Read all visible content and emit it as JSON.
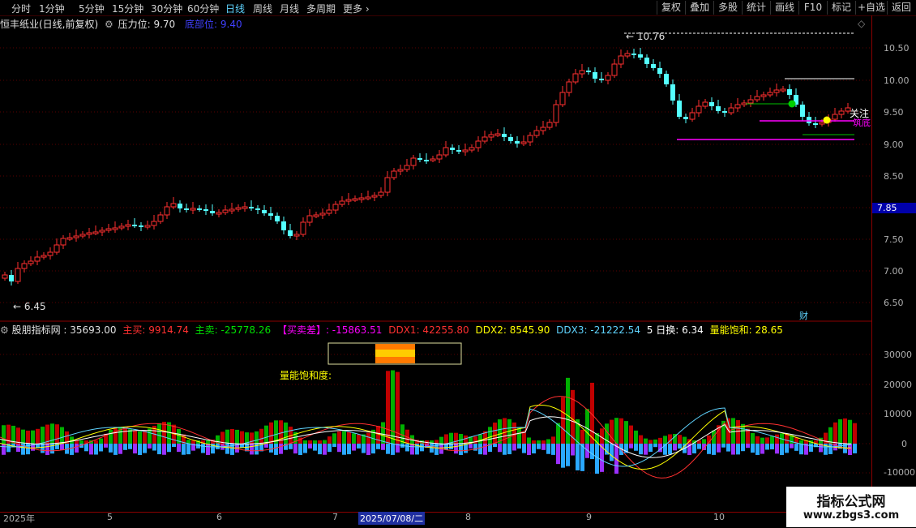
{
  "topbar": {
    "tabs": [
      "分时",
      "1分钟",
      "5分钟",
      "15分钟",
      "30分钟",
      "60分钟",
      "日线",
      "周线",
      "月线",
      "多周期",
      "更多"
    ],
    "active_tab": "日线",
    "right_buttons": [
      "复权",
      "叠加",
      "多股",
      "统计",
      "画线",
      "F10",
      "标记",
      "+自选",
      "返回"
    ]
  },
  "stock": {
    "title": "恒丰纸业(日线,前复权)",
    "pressure_label": "压力位: 9.70",
    "bottom_label": "底部位: 9.40",
    "high_label": "10.76",
    "low_label": "6.45",
    "current_price": "7.85",
    "tag_attention": "关注",
    "tag_bottom": "筑底",
    "tag_cai": "财"
  },
  "yaxis_price": [
    "10.50",
    "10.00",
    "9.50",
    "9.00",
    "8.50",
    "8.00",
    "7.50",
    "7.00",
    "6.50"
  ],
  "indicator": {
    "name": "股朋指标网 : 35693.00",
    "zhumai": "主买: 9914.74",
    "zhumai2": "主卖: -25778.26",
    "diff": "【买卖差】: -15863.51",
    "ddx1": "DDX1: 42255.80",
    "ddx2": "DDX2: 8545.90",
    "ddx3": "DDX3: -21222.54",
    "huan": "5 日换: 6.34",
    "baohe": "量能饱和: 28.65",
    "saturation_label": "量能饱和度:",
    "yaxis": [
      "30000",
      "20000",
      "10000",
      "0",
      "-10000"
    ]
  },
  "timeaxis": {
    "labels": [
      "2025年",
      "5",
      "6",
      "7",
      "2025/07/08/二",
      "8",
      "9",
      "10"
    ]
  },
  "watermark": {
    "line1": "指标公式网",
    "line2": "www.zbgs3.com"
  },
  "colors": {
    "up": "#ff3030",
    "down": "#54ffff",
    "grid": "#5a0000",
    "accent": "#5fd4ff"
  }
}
